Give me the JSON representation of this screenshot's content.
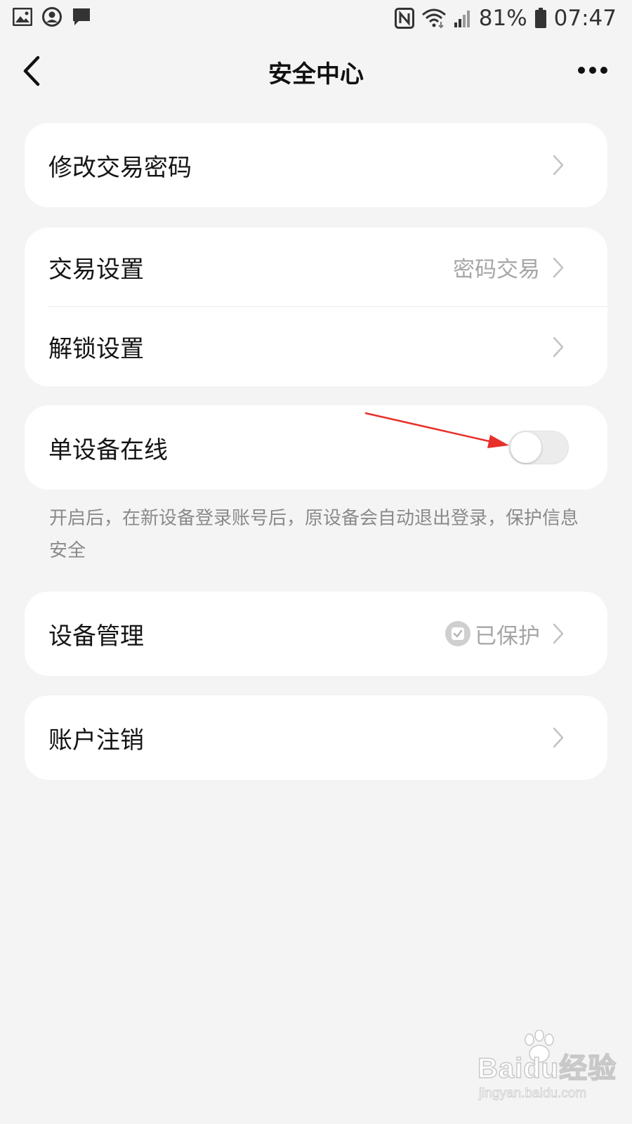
{
  "status_bar": {
    "battery_percent": "81%",
    "time": "07:47",
    "left_icons": [
      "gallery-icon",
      "account-icon",
      "message-icon"
    ],
    "right_icons": [
      "nfc-icon",
      "wifi-icon",
      "signal-icon",
      "battery-icon"
    ]
  },
  "header": {
    "title": "安全中心",
    "back_icon": "back-chevron-icon",
    "more_icon": "more-dots-icon"
  },
  "cards": {
    "change_password": {
      "label": "修改交易密码"
    },
    "trade_settings": {
      "label": "交易设置",
      "value": "密码交易"
    },
    "unlock_settings": {
      "label": "解锁设置"
    },
    "single_device": {
      "label": "单设备在线",
      "enabled": false
    },
    "device_management": {
      "label": "设备管理",
      "value": "已保护"
    },
    "account_cancel": {
      "label": "账户注销"
    }
  },
  "single_device_hint": "开启后，在新设备登录账号后，原设备会自动退出登录，保护信息安全",
  "annotation": {
    "arrow_color": "#e8302a"
  },
  "watermark": {
    "brand": "Baidu经验",
    "url": "jingyan.baidu.com"
  },
  "colors": {
    "background": "#f4f4f4",
    "card": "#ffffff",
    "secondary_text": "#a6a6a6",
    "toggle_off": "#ececec"
  }
}
